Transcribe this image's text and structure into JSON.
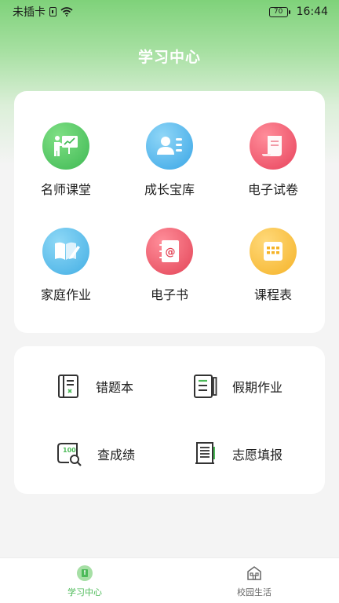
{
  "status_bar": {
    "carrier": "未插卡",
    "battery": "70",
    "time": "16:44"
  },
  "header": {
    "title": "学习中心"
  },
  "grid": [
    {
      "label": "名师课堂",
      "icon": "teacher-presentation-icon",
      "color": "#3fb954"
    },
    {
      "label": "成长宝库",
      "icon": "profile-card-icon",
      "color": "#3aa6e6"
    },
    {
      "label": "电子试卷",
      "icon": "scroll-icon",
      "color": "#e8435c"
    },
    {
      "label": "家庭作业",
      "icon": "open-book-pencil-icon",
      "color": "#43aee4"
    },
    {
      "label": "电子书",
      "icon": "address-book-icon",
      "color": "#e34457"
    },
    {
      "label": "课程表",
      "icon": "schedule-grid-icon",
      "color": "#f5b328"
    }
  ],
  "list": [
    {
      "label": "错题本",
      "icon": "notebook-icon"
    },
    {
      "label": "假期作业",
      "icon": "document-pen-icon"
    },
    {
      "label": "查成绩",
      "icon": "score-search-icon"
    },
    {
      "label": "志愿填报",
      "icon": "scroll-form-icon"
    }
  ],
  "tabs": [
    {
      "label": "学习中心",
      "icon": "study-center-icon",
      "active": true
    },
    {
      "label": "校园生活",
      "icon": "school-building-icon",
      "active": false
    }
  ],
  "colors": {
    "accent": "#4cba58",
    "header_green": "#7fd27a"
  }
}
